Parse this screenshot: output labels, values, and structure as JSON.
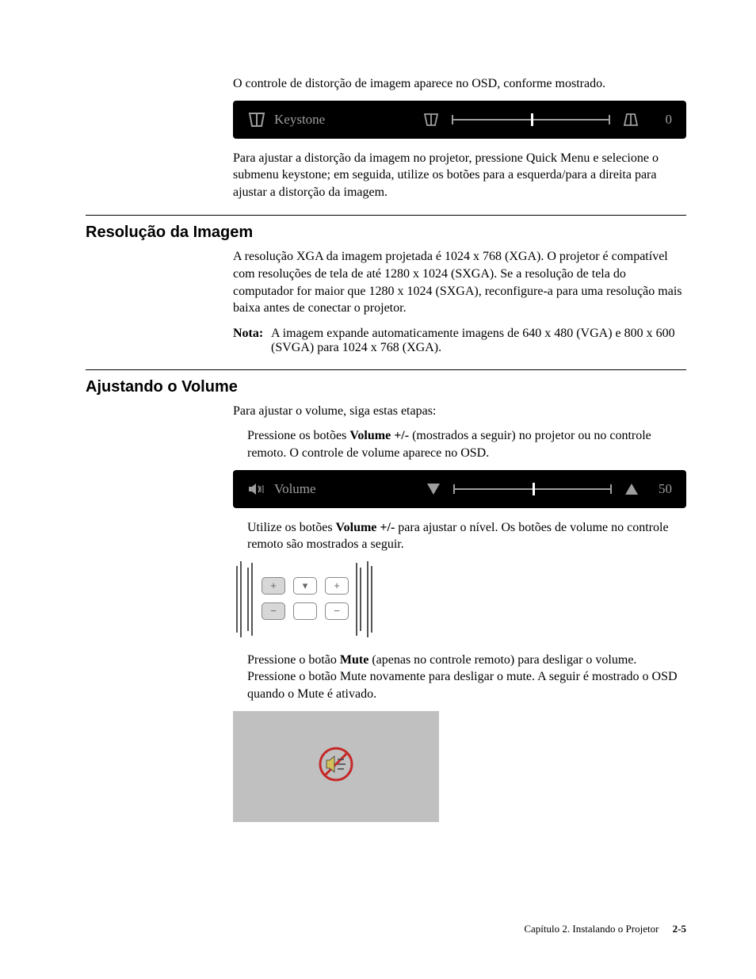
{
  "intro": {
    "p1": "O controle de distorção de imagem aparece no OSD, conforme mostrado.",
    "p2": "Para ajustar a distorção da imagem no projetor, pressione Quick Menu e selecione o submenu keystone; em seguida, utilize os botões para a esquerda/para a direita para ajustar a distorção da imagem."
  },
  "osd_keystone": {
    "label": "Keystone",
    "value": "0"
  },
  "section_resolution": {
    "title": "Resolução da Imagem",
    "p1": "A resolução XGA da imagem projetada é 1024 x 768 (XGA). O projetor é compatível com resoluções de tela de até 1280 x 1024 (SXGA). Se a resolução de tela do computador for maior que 1280 x 1024 (SXGA), reconfigure-a para uma resolução mais baixa antes de conectar o projetor.",
    "note_label": "Nota:",
    "note_text": "A imagem expande automaticamente imagens de 640 x 480 (VGA) e 800 x 600 (SVGA) para 1024 x 768 (XGA)."
  },
  "section_volume": {
    "title": "Ajustando o Volume",
    "p1": "Para ajustar o volume, siga estas etapas:",
    "p2a": "Pressione os botões ",
    "p2b_bold": "Volume +/-",
    "p2c": " (mostrados a seguir) no projetor ou no controle remoto. O controle de volume aparece no OSD.",
    "p3a": "Utilize os botões ",
    "p3b_bold": "Volume +/-",
    "p3c": " para ajustar o nível. Os botões de volume no controle remoto são mostrados a seguir.",
    "p4a": "Pressione o botão ",
    "p4b_bold": "Mute",
    "p4c": " (apenas no controle remoto) para desligar o volume. Pressione o botão Mute novamente para desligar o mute. A seguir é mostrado o OSD quando o Mute é ativado."
  },
  "osd_volume": {
    "label": "Volume",
    "value": "50"
  },
  "remote_buttons": {
    "top_left": "+",
    "top_mid": "▾",
    "top_right": "+",
    "bot_left": "−",
    "bot_mid": "",
    "bot_right": "−"
  },
  "footer": {
    "chapter": "Capítulo 2. Instalando o Projetor",
    "page": "2-5"
  }
}
